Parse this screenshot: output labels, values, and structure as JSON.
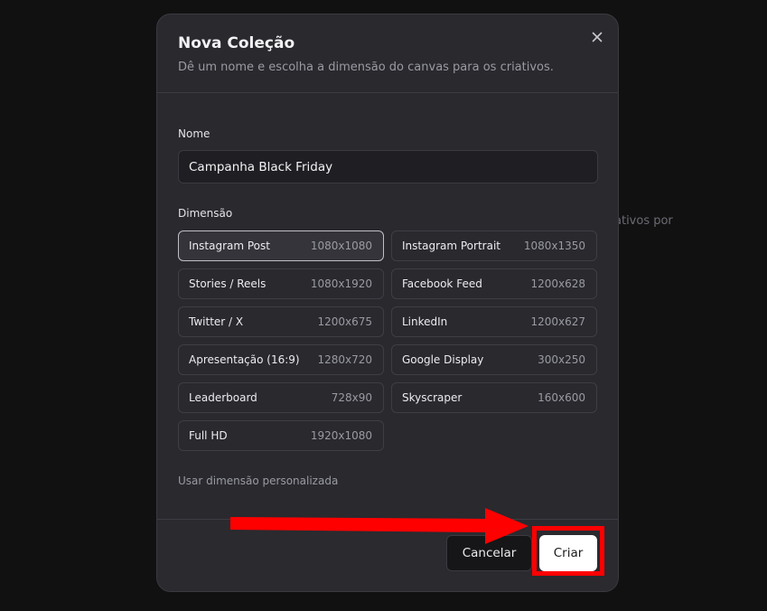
{
  "background": {
    "partial_text": "ativos por"
  },
  "modal": {
    "title": "Nova Coleção",
    "subtitle": "Dê um nome e escolha a dimensão do canvas para os criativos.",
    "close_icon": "close-icon"
  },
  "name_field": {
    "label": "Nome",
    "value": "Campanha Black Friday"
  },
  "dimension": {
    "label": "Dimensão",
    "options": [
      {
        "name": "Instagram Post",
        "size": "1080x1080",
        "selected": true
      },
      {
        "name": "Instagram Portrait",
        "size": "1080x1350",
        "selected": false
      },
      {
        "name": "Stories / Reels",
        "size": "1080x1920",
        "selected": false
      },
      {
        "name": "Facebook Feed",
        "size": "1200x628",
        "selected": false
      },
      {
        "name": "Twitter / X",
        "size": "1200x675",
        "selected": false
      },
      {
        "name": "LinkedIn",
        "size": "1200x627",
        "selected": false
      },
      {
        "name": "Apresentação (16:9)",
        "size": "1280x720",
        "selected": false
      },
      {
        "name": "Google Display",
        "size": "300x250",
        "selected": false
      },
      {
        "name": "Leaderboard",
        "size": "728x90",
        "selected": false
      },
      {
        "name": "Skyscraper",
        "size": "160x600",
        "selected": false
      },
      {
        "name": "Full HD",
        "size": "1920x1080",
        "selected": false
      }
    ],
    "custom_link": "Usar dimensão personalizada"
  },
  "footer": {
    "cancel_label": "Cancelar",
    "create_label": "Criar"
  },
  "annotation": {
    "color": "#ff0000",
    "arrow_icon": "arrow-right-icon"
  }
}
